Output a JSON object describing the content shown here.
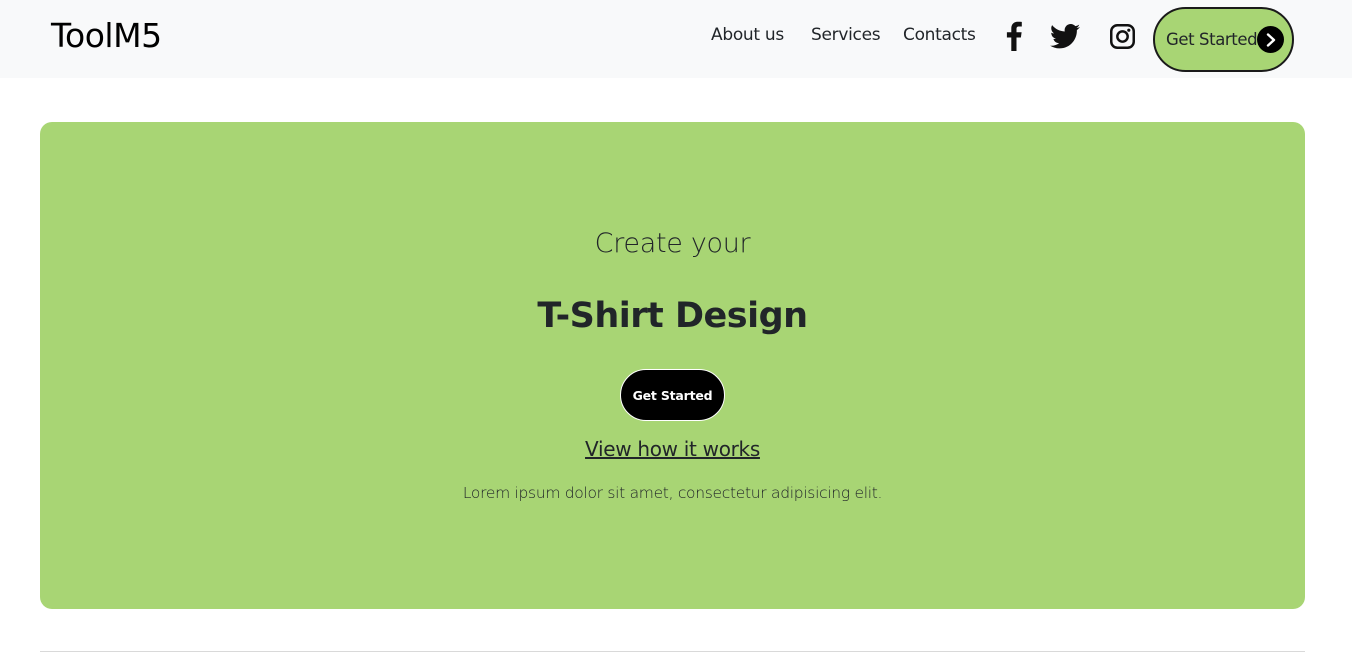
{
  "navbar": {
    "brand": "ToolM5",
    "links": [
      "About us",
      "Services",
      "Contacts"
    ],
    "social": [
      "facebook-icon",
      "twitter-icon",
      "instagram-icon"
    ],
    "cta_label": "Get Started"
  },
  "hero": {
    "pretitle": "Create your",
    "title": "T-Shirt Design",
    "cta_label": "Get Started",
    "link_label": "View how it works",
    "description": "Lorem ipsum dolor sit amet, consectetur adipisicing elit."
  },
  "colors": {
    "accent": "#a8d574",
    "navbar_bg": "#f8f9fa",
    "text": "#212529",
    "button_dark": "#000000"
  }
}
